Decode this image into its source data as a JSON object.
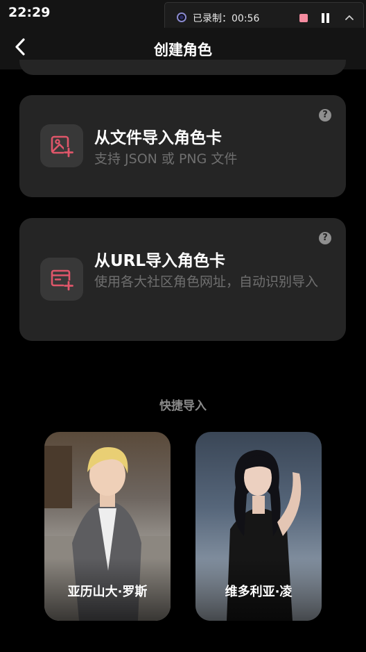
{
  "status": {
    "time": "22:29",
    "recording": {
      "label": "已录制：00:56",
      "stop_color": "#f58ca0"
    }
  },
  "header": {
    "title": "创建角色",
    "back_icon": "chevron-left-icon"
  },
  "import_cards": [
    {
      "title": "从文件导入角色卡",
      "description": "支持 JSON 或 PNG 文件",
      "icon": "image-add-icon",
      "help_icon": "?"
    },
    {
      "title": "从URL导入角色卡",
      "description": "使用各大社区角色网址，自动识别导入",
      "icon": "browser-add-icon",
      "help_icon": "?"
    }
  ],
  "quick_import": {
    "label": "快捷导入",
    "characters": [
      {
        "name": "亚历山大·罗斯"
      },
      {
        "name": "维多利亚·凌"
      }
    ]
  },
  "colors": {
    "background": "#000000",
    "card": "#252525",
    "accent_icon": "#e0566a",
    "muted_text": "#6f6f6f"
  }
}
